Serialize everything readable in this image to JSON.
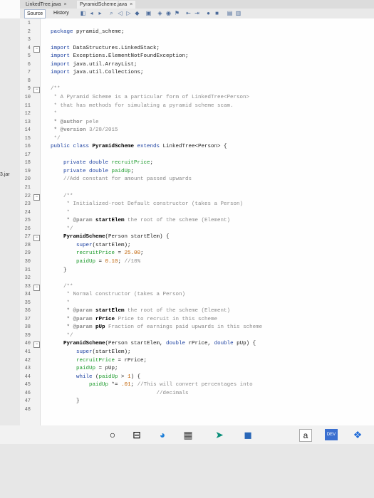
{
  "tabs": [
    {
      "label": "LinkedTree.java",
      "close": "×"
    },
    {
      "label": "PyramidScheme.java",
      "close": "×"
    }
  ],
  "toolbar": {
    "source_label": "Source",
    "history_label": "History"
  },
  "left_pane": {
    "jar_label": "3.jar"
  },
  "lines": [
    {
      "n": "1",
      "segs": []
    },
    {
      "n": "2",
      "segs": [
        {
          "c": "kw",
          "t": "package"
        },
        {
          "c": "",
          "t": " pyramid_scheme;"
        }
      ]
    },
    {
      "n": "3",
      "segs": []
    },
    {
      "n": "4",
      "segs": [
        {
          "c": "kw",
          "t": "import"
        },
        {
          "c": "",
          "t": " DataStructures.LinkedStack;"
        }
      ]
    },
    {
      "n": "5",
      "segs": [
        {
          "c": "kw",
          "t": "import"
        },
        {
          "c": "",
          "t": " Exceptions.ElementNotFoundException;"
        }
      ]
    },
    {
      "n": "6",
      "segs": [
        {
          "c": "kw",
          "t": "import"
        },
        {
          "c": "",
          "t": " java.util.ArrayList;"
        }
      ]
    },
    {
      "n": "7",
      "segs": [
        {
          "c": "kw",
          "t": "import"
        },
        {
          "c": "",
          "t": " java.util.Collections;"
        }
      ]
    },
    {
      "n": "8",
      "segs": []
    },
    {
      "n": "9",
      "segs": [
        {
          "c": "cm",
          "t": "/**"
        }
      ]
    },
    {
      "n": "10",
      "segs": [
        {
          "c": "cm",
          "t": " * A Pyramid Scheme is a particular form of LinkedTree<Person>"
        }
      ]
    },
    {
      "n": "11",
      "segs": [
        {
          "c": "cm",
          "t": " * that has methods for simulating a pyramid scheme scam."
        }
      ]
    },
    {
      "n": "12",
      "segs": [
        {
          "c": "cm",
          "t": " *"
        }
      ]
    },
    {
      "n": "13",
      "segs": [
        {
          "c": "at",
          "t": " * @author"
        },
        {
          "c": "cm",
          "t": " pele"
        }
      ]
    },
    {
      "n": "14",
      "segs": [
        {
          "c": "at",
          "t": " * @version"
        },
        {
          "c": "cm",
          "t": " 3/28/2015"
        }
      ]
    },
    {
      "n": "15",
      "segs": [
        {
          "c": "cm",
          "t": " */"
        }
      ]
    },
    {
      "n": "16",
      "segs": [
        {
          "c": "kw",
          "t": "public class"
        },
        {
          "c": "hl",
          "t": " PyramidScheme"
        },
        {
          "c": "kw",
          "t": " extends"
        },
        {
          "c": "",
          "t": " LinkedTree<Person> {"
        }
      ]
    },
    {
      "n": "17",
      "segs": []
    },
    {
      "n": "18",
      "segs": [
        {
          "c": "kw",
          "t": "    private double"
        },
        {
          "c": "fld",
          "t": " recruitPrice"
        },
        {
          "c": "",
          "t": ";"
        }
      ]
    },
    {
      "n": "19",
      "segs": [
        {
          "c": "kw",
          "t": "    private double"
        },
        {
          "c": "fld",
          "t": " paidUp"
        },
        {
          "c": "",
          "t": ";"
        }
      ]
    },
    {
      "n": "20",
      "segs": [
        {
          "c": "cm",
          "t": "    //Add constant for amount passed upwards"
        }
      ]
    },
    {
      "n": "21",
      "segs": []
    },
    {
      "n": "22",
      "segs": [
        {
          "c": "cm",
          "t": "    /**"
        }
      ]
    },
    {
      "n": "23",
      "segs": [
        {
          "c": "cm",
          "t": "     * Initialized-root Default constructor (takes a Person)"
        }
      ]
    },
    {
      "n": "24",
      "segs": [
        {
          "c": "cm",
          "t": "     *"
        }
      ]
    },
    {
      "n": "25",
      "segs": [
        {
          "c": "at",
          "t": "     * @param"
        },
        {
          "c": "hl",
          "t": " startElem"
        },
        {
          "c": "cm",
          "t": " the root of the scheme (Element)"
        }
      ]
    },
    {
      "n": "26",
      "segs": [
        {
          "c": "cm",
          "t": "     */"
        }
      ]
    },
    {
      "n": "27",
      "segs": [
        {
          "c": "hl",
          "t": "    PyramidScheme"
        },
        {
          "c": "",
          "t": "(Person startElem) {"
        }
      ]
    },
    {
      "n": "28",
      "segs": [
        {
          "c": "kw",
          "t": "        super"
        },
        {
          "c": "",
          "t": "(startElem);"
        }
      ]
    },
    {
      "n": "29",
      "segs": [
        {
          "c": "fld",
          "t": "        recruitPrice"
        },
        {
          "c": "",
          "t": " = "
        },
        {
          "c": "num",
          "t": "25.00"
        },
        {
          "c": "",
          "t": ";"
        }
      ]
    },
    {
      "n": "30",
      "segs": [
        {
          "c": "fld",
          "t": "        paidUp"
        },
        {
          "c": "",
          "t": " = "
        },
        {
          "c": "num",
          "t": "0.10"
        },
        {
          "c": "",
          "t": "; "
        },
        {
          "c": "cm",
          "t": "//10%"
        }
      ]
    },
    {
      "n": "31",
      "segs": [
        {
          "c": "",
          "t": "    }"
        }
      ]
    },
    {
      "n": "32",
      "segs": []
    },
    {
      "n": "33",
      "segs": [
        {
          "c": "cm",
          "t": "    /**"
        }
      ]
    },
    {
      "n": "34",
      "segs": [
        {
          "c": "cm",
          "t": "     * Normal constructor (takes a Person)"
        }
      ]
    },
    {
      "n": "35",
      "segs": [
        {
          "c": "cm",
          "t": "     *"
        }
      ]
    },
    {
      "n": "36",
      "segs": [
        {
          "c": "at",
          "t": "     * @param"
        },
        {
          "c": "hl",
          "t": " startElem"
        },
        {
          "c": "cm",
          "t": " the root of the scheme (Element)"
        }
      ]
    },
    {
      "n": "37",
      "segs": [
        {
          "c": "at",
          "t": "     * @param"
        },
        {
          "c": "hl",
          "t": " rPrice"
        },
        {
          "c": "cm",
          "t": " Price to recruit in this scheme"
        }
      ]
    },
    {
      "n": "38",
      "segs": [
        {
          "c": "at",
          "t": "     * @param"
        },
        {
          "c": "hl",
          "t": " pUp"
        },
        {
          "c": "cm",
          "t": " Fraction of earnings paid upwards in this scheme"
        }
      ]
    },
    {
      "n": "39",
      "segs": [
        {
          "c": "cm",
          "t": "     */"
        }
      ]
    },
    {
      "n": "40",
      "segs": [
        {
          "c": "hl",
          "t": "    PyramidScheme"
        },
        {
          "c": "",
          "t": "(Person startElem, "
        },
        {
          "c": "kw",
          "t": "double"
        },
        {
          "c": "",
          "t": " rPrice, "
        },
        {
          "c": "kw",
          "t": "double"
        },
        {
          "c": "",
          "t": " pUp) {"
        }
      ]
    },
    {
      "n": "41",
      "segs": [
        {
          "c": "kw",
          "t": "        super"
        },
        {
          "c": "",
          "t": "(startElem);"
        }
      ]
    },
    {
      "n": "42",
      "segs": [
        {
          "c": "fld",
          "t": "        recruitPrice"
        },
        {
          "c": "",
          "t": " = rPrice;"
        }
      ]
    },
    {
      "n": "43",
      "segs": [
        {
          "c": "fld",
          "t": "        paidUp"
        },
        {
          "c": "",
          "t": " = pUp;"
        }
      ]
    },
    {
      "n": "44",
      "segs": [
        {
          "c": "kw",
          "t": "        while"
        },
        {
          "c": "",
          "t": " ("
        },
        {
          "c": "fld",
          "t": "paidUp"
        },
        {
          "c": "",
          "t": " > "
        },
        {
          "c": "num",
          "t": "1"
        },
        {
          "c": "",
          "t": ") {"
        }
      ]
    },
    {
      "n": "45",
      "segs": [
        {
          "c": "fld",
          "t": "            paidUp"
        },
        {
          "c": "",
          "t": " *= "
        },
        {
          "c": "num",
          "t": ".01"
        },
        {
          "c": "",
          "t": "; "
        },
        {
          "c": "cm",
          "t": "//This will convert percentages into"
        }
      ]
    },
    {
      "n": "46",
      "segs": [
        {
          "c": "cm",
          "t": "                                 //decimals"
        }
      ]
    },
    {
      "n": "47",
      "segs": [
        {
          "c": "",
          "t": "        }"
        }
      ]
    },
    {
      "n": "48",
      "segs": []
    }
  ],
  "taskbar": {
    "icons": [
      "start-circle-icon",
      "task-view-icon",
      "edge-browser-icon",
      "store-icon",
      "sendto-icon",
      "netbeans-icon",
      "amazon-icon",
      "devlogo-icon",
      "dropbox-icon"
    ],
    "amazon_label": "a",
    "dev_label": "DEV"
  }
}
